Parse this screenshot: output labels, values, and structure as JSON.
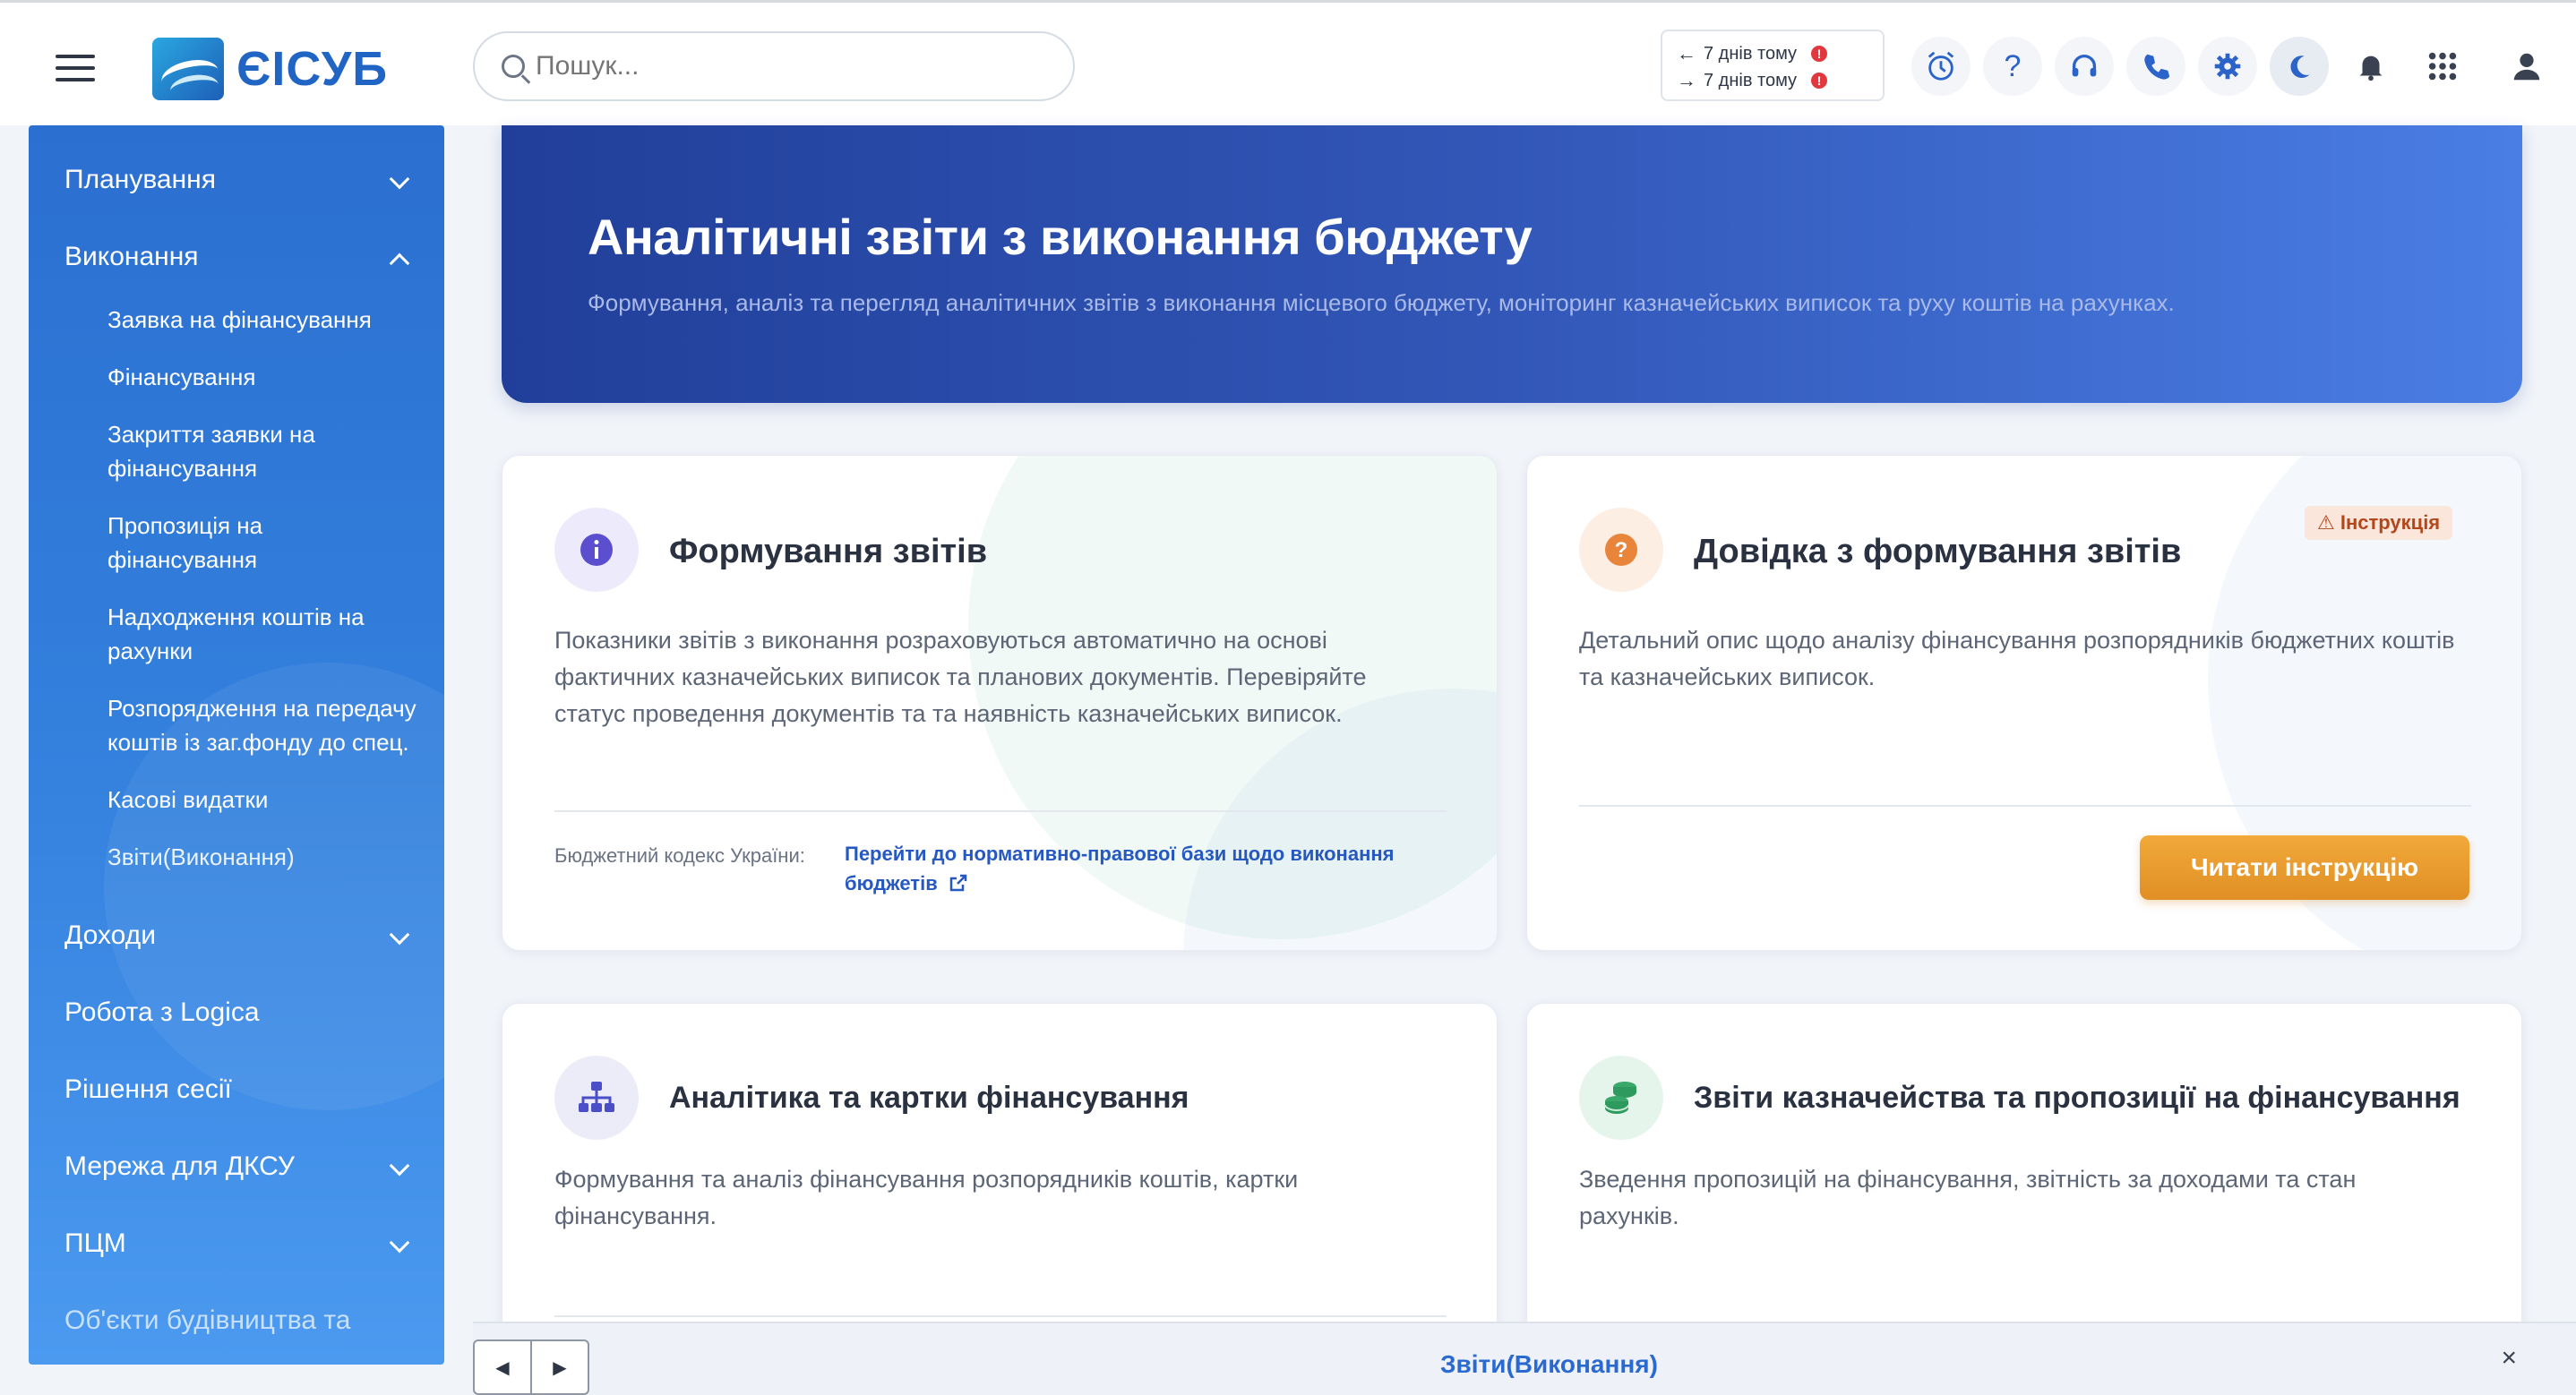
{
  "app": {
    "logo_text": "ЄІСУБ"
  },
  "search": {
    "placeholder": "Пошук..."
  },
  "history": {
    "back_label": "7 днів тому",
    "forward_label": "7 днів тому",
    "back_arrow": "←",
    "forward_arrow": "→",
    "alert": "!"
  },
  "topbar_icons": [
    {
      "name": "alarm-clock-icon"
    },
    {
      "name": "help-icon",
      "glyph": "?"
    },
    {
      "name": "headset-icon"
    },
    {
      "name": "phone-icon"
    },
    {
      "name": "gear-icon"
    },
    {
      "name": "moon-icon"
    },
    {
      "name": "bell-icon"
    },
    {
      "name": "apps-grid-icon"
    },
    {
      "name": "user-icon"
    }
  ],
  "sidebar": {
    "items": [
      {
        "label": "Планування"
      },
      {
        "label": "Виконання"
      },
      {
        "label": "Доходи"
      },
      {
        "label": "Робота з Logica"
      },
      {
        "label": "Рішення сесії"
      },
      {
        "label": "Мережа для ДКСУ"
      },
      {
        "label": "ПЦМ"
      },
      {
        "label": "Об'єкти будівництва та"
      }
    ],
    "sub_items": [
      {
        "label": "Заявка на фінансування"
      },
      {
        "label": "Фінансування"
      },
      {
        "label": "Закриття заявки на фінансування"
      },
      {
        "label": "Пропозиція на фінансування"
      },
      {
        "label": "Надходження коштів на рахунки"
      },
      {
        "label": "Розпорядження на передачу коштів із заг.фонду до спец."
      },
      {
        "label": "Касові видатки"
      },
      {
        "label": "Звіти(Виконання)"
      }
    ]
  },
  "hero": {
    "title": "Аналітичні звіти з виконання бюджету",
    "subtitle": "Формування, аналіз та перегляд аналітичних звітів з виконання місцевого бюджету, моніторинг казначейських виписок та руху коштів на рахунках."
  },
  "cards": [
    {
      "title": "Формування звітів",
      "text": "Показники звітів з виконання розраховуються автоматично на основі фактичних казначейських виписок та планових документів. Перевіряйте статус проведення документів та та наявність казначейських виписок.",
      "footer_label": "Бюджетний кодекс України:",
      "footer_link": "Перейти до нормативно-правової бази щодо виконання бюджетів",
      "icon_color": "#5b4fcf"
    },
    {
      "title": "Довідка з формування звітів",
      "text": "Детальний опис щодо аналізу фінансування розпорядників бюджетних коштів та казначейських виписок.",
      "badge": "Інструкція",
      "button": "Читати інструкцію",
      "icon_color": "#e8853a"
    },
    {
      "title": "Аналітика та картки фінансування",
      "text": "Формування та аналіз фінансування розпорядників коштів, картки фінансування.",
      "icon_color": "#4a4fc7"
    },
    {
      "title": "Звіти казначейства та пропозиції на фінансування",
      "text": "Зведення пропозицій на фінансування, звітність за доходами та стан рахунків.",
      "icon_color": "#3aa86b"
    }
  ],
  "bottom_bar": {
    "tab_title": "Звіти(Виконання)",
    "prev": "◀",
    "next": "▶",
    "close": "×"
  }
}
